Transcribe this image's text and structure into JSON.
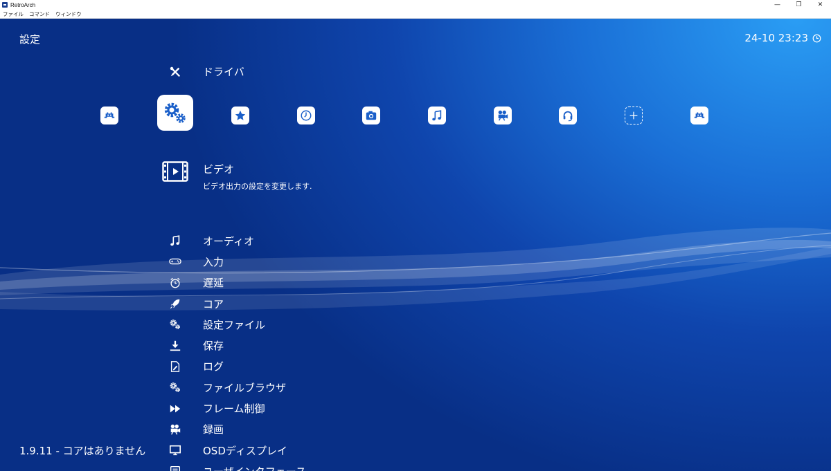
{
  "window": {
    "title": "RetroArch",
    "minimize": "—",
    "restore": "❐",
    "close": "✕"
  },
  "menubar": [
    "ファイル",
    "コマンド",
    "ウィンドウ"
  ],
  "header": {
    "title": "設定",
    "clock": "24-10 23:23"
  },
  "top_item": {
    "label": "ドライバ",
    "icon": "tools-icon"
  },
  "tabs": [
    {
      "name": "main-menu",
      "icon": "retroarch-invader-icon"
    },
    {
      "name": "settings",
      "icon": "gears-icon",
      "selected": true
    },
    {
      "name": "favorites",
      "icon": "star-icon"
    },
    {
      "name": "history",
      "icon": "clock-icon"
    },
    {
      "name": "images",
      "icon": "camera-icon"
    },
    {
      "name": "music",
      "icon": "music-icon"
    },
    {
      "name": "video",
      "icon": "film-camera-icon"
    },
    {
      "name": "netplay",
      "icon": "headset-icon"
    },
    {
      "name": "add",
      "icon": "plus-icon"
    },
    {
      "name": "content",
      "icon": "retroarch-invader-icon"
    }
  ],
  "active_item": {
    "label": "ビデオ",
    "description": "ビデオ出力の設定を変更します.",
    "icon": "video-film-icon"
  },
  "list": [
    {
      "label": "オーディオ",
      "icon": "music-note-icon"
    },
    {
      "label": "入力",
      "icon": "gamepad-icon"
    },
    {
      "label": "遅延",
      "icon": "alarm-clock-icon"
    },
    {
      "label": "コア",
      "icon": "rocket-icon"
    },
    {
      "label": "設定ファイル",
      "icon": "gears-icon"
    },
    {
      "label": "保存",
      "icon": "download-icon"
    },
    {
      "label": "ログ",
      "icon": "log-file-icon"
    },
    {
      "label": "ファイルブラウザ",
      "icon": "gears-icon"
    },
    {
      "label": "フレーム制御",
      "icon": "fast-forward-icon"
    },
    {
      "label": "録画",
      "icon": "film-camera-icon"
    },
    {
      "label": "OSDディスプレイ",
      "icon": "monitor-icon"
    },
    {
      "label": "ユーザインタフェース",
      "icon": "ui-list-icon"
    }
  ],
  "version": "1.9.11 - コアはありません",
  "colors": {
    "bg_dark": "#082f86",
    "bg_light": "#2a9df4",
    "tab_icon_fg": "#1a5fc9"
  }
}
